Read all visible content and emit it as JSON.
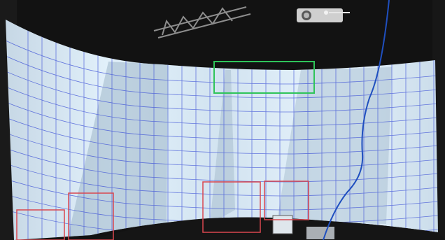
{
  "scene": {
    "colors": {
      "ceiling": "#131313",
      "screen_light": "#dff0fa",
      "screen_mid": "#c7dbea",
      "screen_dark": "#7f96a8",
      "grid": "#3b4fd6",
      "green_box": "#2fc45a",
      "red_box": "#d9474f",
      "cable": "#1f4fbf"
    },
    "overlays": [
      {
        "label": "",
        "color": "green"
      },
      {
        "label": "",
        "color": "red"
      },
      {
        "label": "",
        "color": "red"
      },
      {
        "label": "",
        "color": "red"
      },
      {
        "label": "",
        "color": "red"
      }
    ]
  }
}
